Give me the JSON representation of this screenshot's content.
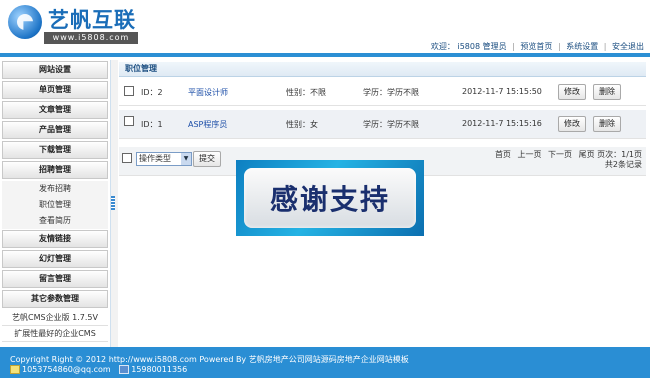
{
  "header": {
    "logo_text": "艺帆互联",
    "logo_url": "www.i5808.com",
    "welcome": "欢迎：",
    "user": "i5808",
    "role": "管理员",
    "nav": [
      "预览首页",
      "系统设置",
      "安全退出"
    ]
  },
  "sidebar": {
    "sections": [
      "网站设置",
      "单页管理",
      "文章管理",
      "产品管理",
      "下载管理",
      "招聘管理"
    ],
    "sub_items": [
      "发布招聘",
      "职位管理",
      "查看简历"
    ],
    "sections2": [
      "友情链接",
      "幻灯管理",
      "留言管理",
      "其它参数管理"
    ],
    "info": [
      "艺帆CMS企业版 1.7.5V",
      "扩展性最好的企业CMS"
    ]
  },
  "main": {
    "title": "职位管理",
    "rows": [
      {
        "id": "ID：2",
        "name": "平面设计师",
        "gender": "性别：不限",
        "edu": "学历：学历不限",
        "date": "2012-11-7 15:15:50",
        "edit": "修改",
        "del": "删除"
      },
      {
        "id": "ID：1",
        "name": "ASP程序员",
        "gender": "性别：女",
        "edu": "学历：学历不限",
        "date": "2012-11-7 15:15:16",
        "edit": "修改",
        "del": "删除"
      }
    ],
    "select_value": "操作类型",
    "submit": "提交",
    "pager_links": [
      "首页",
      "上一页",
      "下一页",
      "尾页"
    ],
    "pager_info": "页次：1/1页",
    "total": "共2条记录"
  },
  "overlay": {
    "text": "感谢支持"
  },
  "footer": {
    "copyright": "Copyright Right © 2012 http://www.i5808.com Powered By 艺帆房地产公司网站源码房地产企业网站模板",
    "email": "1053754860@qq.com",
    "phone": "15980011356"
  }
}
